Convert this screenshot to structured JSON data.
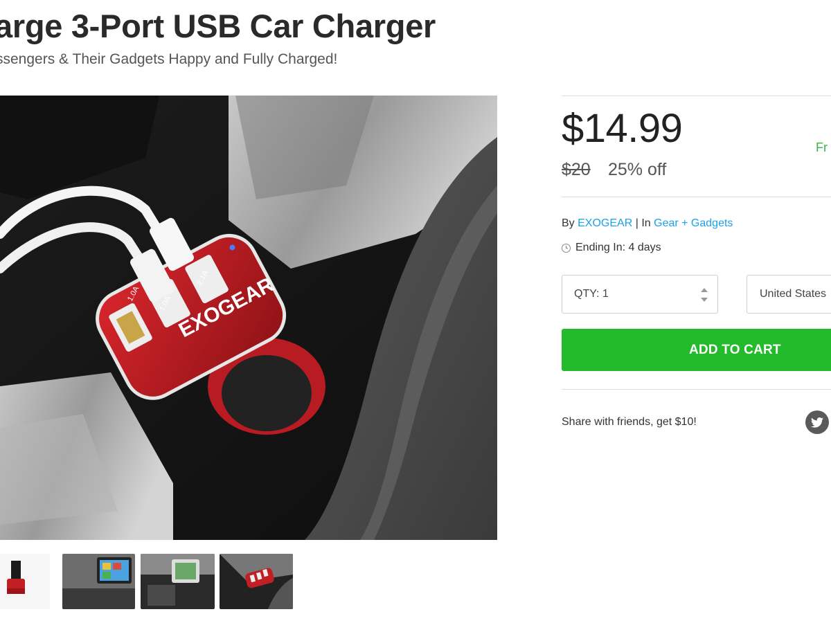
{
  "product": {
    "title": "arge 3-Port USB Car Charger",
    "subtitle": "ssengers & Their Gadgets Happy and Fully Charged!",
    "image_text": {
      "brand": "EXOGEAR",
      "port_1": "1.0A",
      "port_2": "1.0A",
      "port_3": "2.1A"
    }
  },
  "pricing": {
    "price": "$14.99",
    "original_price": "$20",
    "discount": "25% off",
    "shipping": "Fr"
  },
  "meta": {
    "by_label": "By",
    "vendor": "EXOGEAR",
    "separator": "|",
    "in_label": "In",
    "category": "Gear + Gadgets",
    "ending": "Ending In: 4 days"
  },
  "purchase": {
    "qty_label": "QTY: 1",
    "country": "United States",
    "add_to_cart": "ADD TO CART"
  },
  "share": {
    "text": "Share with friends, get $10!",
    "twitter_icon": "twitter-icon"
  },
  "colors": {
    "accent_green": "#23bb2b",
    "link_blue": "#1aa1e8",
    "shipping_green": "#3bb54a",
    "product_red": "#c01f24"
  }
}
